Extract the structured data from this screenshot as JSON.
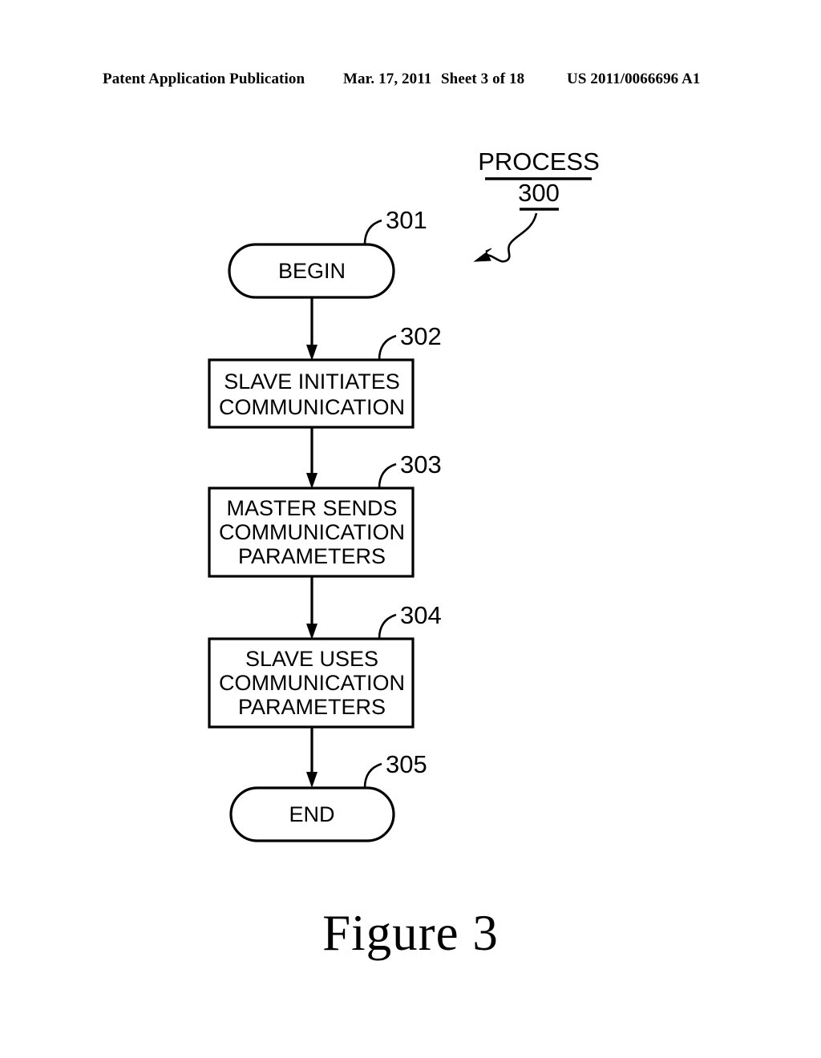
{
  "header": {
    "publication": "Patent Application Publication",
    "date": "Mar. 17, 2011",
    "sheet": "Sheet 3 of 18",
    "patent_number": "US 2011/0066696 A1"
  },
  "figure": {
    "caption": "Figure 3",
    "title": "PROCESS",
    "title_number": "300",
    "nodes": [
      {
        "id": "begin",
        "shape": "stadium",
        "ref": "301",
        "lines": [
          "BEGIN"
        ]
      },
      {
        "id": "step-302",
        "shape": "rect",
        "ref": "302",
        "lines": [
          "SLAVE INITIATES",
          "COMMUNICATION"
        ]
      },
      {
        "id": "step-303",
        "shape": "rect",
        "ref": "303",
        "lines": [
          "MASTER SENDS",
          "COMMUNICATION",
          "PARAMETERS"
        ]
      },
      {
        "id": "step-304",
        "shape": "rect",
        "ref": "304",
        "lines": [
          "SLAVE USES",
          "COMMUNICATION",
          "PARAMETERS"
        ]
      },
      {
        "id": "end",
        "shape": "stadium",
        "ref": "305",
        "lines": [
          "END"
        ]
      }
    ],
    "ink_color": "#000000",
    "paper_color": "#ffffff"
  }
}
